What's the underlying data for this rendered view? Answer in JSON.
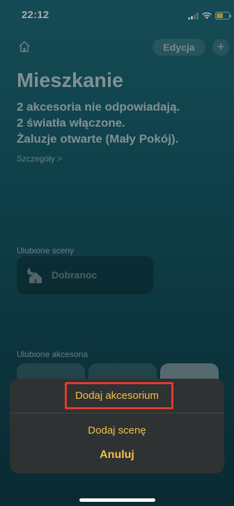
{
  "status_bar": {
    "time": "22:12"
  },
  "header": {
    "edit_label": "Edycja",
    "add_label": "+"
  },
  "home": {
    "title": "Mieszkanie",
    "status_lines": [
      "2 akcesoria nie odpowiadają.",
      "2 światła włączone.",
      "Żaluzje otwarte (Mały Pokój)."
    ],
    "details_link": "Szczegóły >"
  },
  "favorite_scenes": {
    "label": "Ulubione sceny",
    "items": [
      {
        "label": "Dobranoc",
        "icon": "goodnight-scene-icon"
      }
    ]
  },
  "favorite_accessories": {
    "label": "Ulubione akcesoria"
  },
  "action_sheet": {
    "items": [
      {
        "label": "Dodaj akcesorium"
      },
      {
        "label": "Dodaj scenę"
      }
    ],
    "cancel_label": "Anuluj"
  },
  "colors": {
    "accent": "#f1c047",
    "highlight": "#e53a2d"
  }
}
